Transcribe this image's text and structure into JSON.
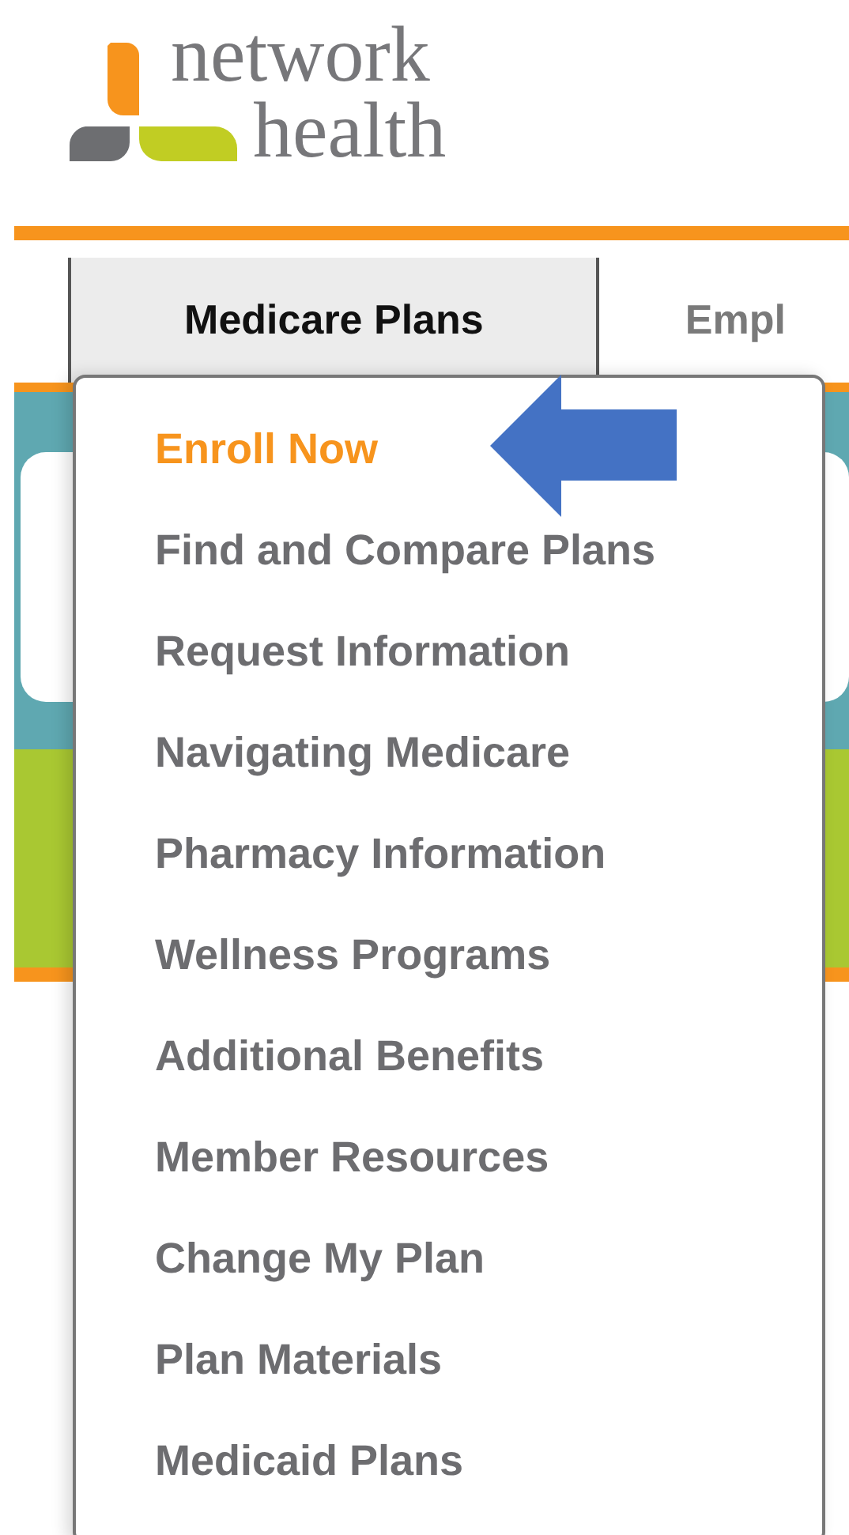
{
  "logo": {
    "line_1": "network",
    "line_2": "health"
  },
  "nav": {
    "tabs": [
      {
        "label": "Medicare Plans",
        "selected": true
      },
      {
        "label": "Empl",
        "selected": false
      }
    ]
  },
  "dropdown": {
    "items": [
      {
        "label": "Enroll Now",
        "selected": true
      },
      {
        "label": "Find and Compare Plans",
        "selected": false
      },
      {
        "label": "Request Information",
        "selected": false
      },
      {
        "label": "Navigating Medicare",
        "selected": false
      },
      {
        "label": "Pharmacy Information",
        "selected": false
      },
      {
        "label": "Wellness Programs",
        "selected": false
      },
      {
        "label": "Additional Benefits",
        "selected": false
      },
      {
        "label": "Member Resources",
        "selected": false
      },
      {
        "label": "Change My Plan",
        "selected": false
      },
      {
        "label": "Plan Materials",
        "selected": false
      },
      {
        "label": "Medicaid Plans",
        "selected": false
      }
    ]
  }
}
